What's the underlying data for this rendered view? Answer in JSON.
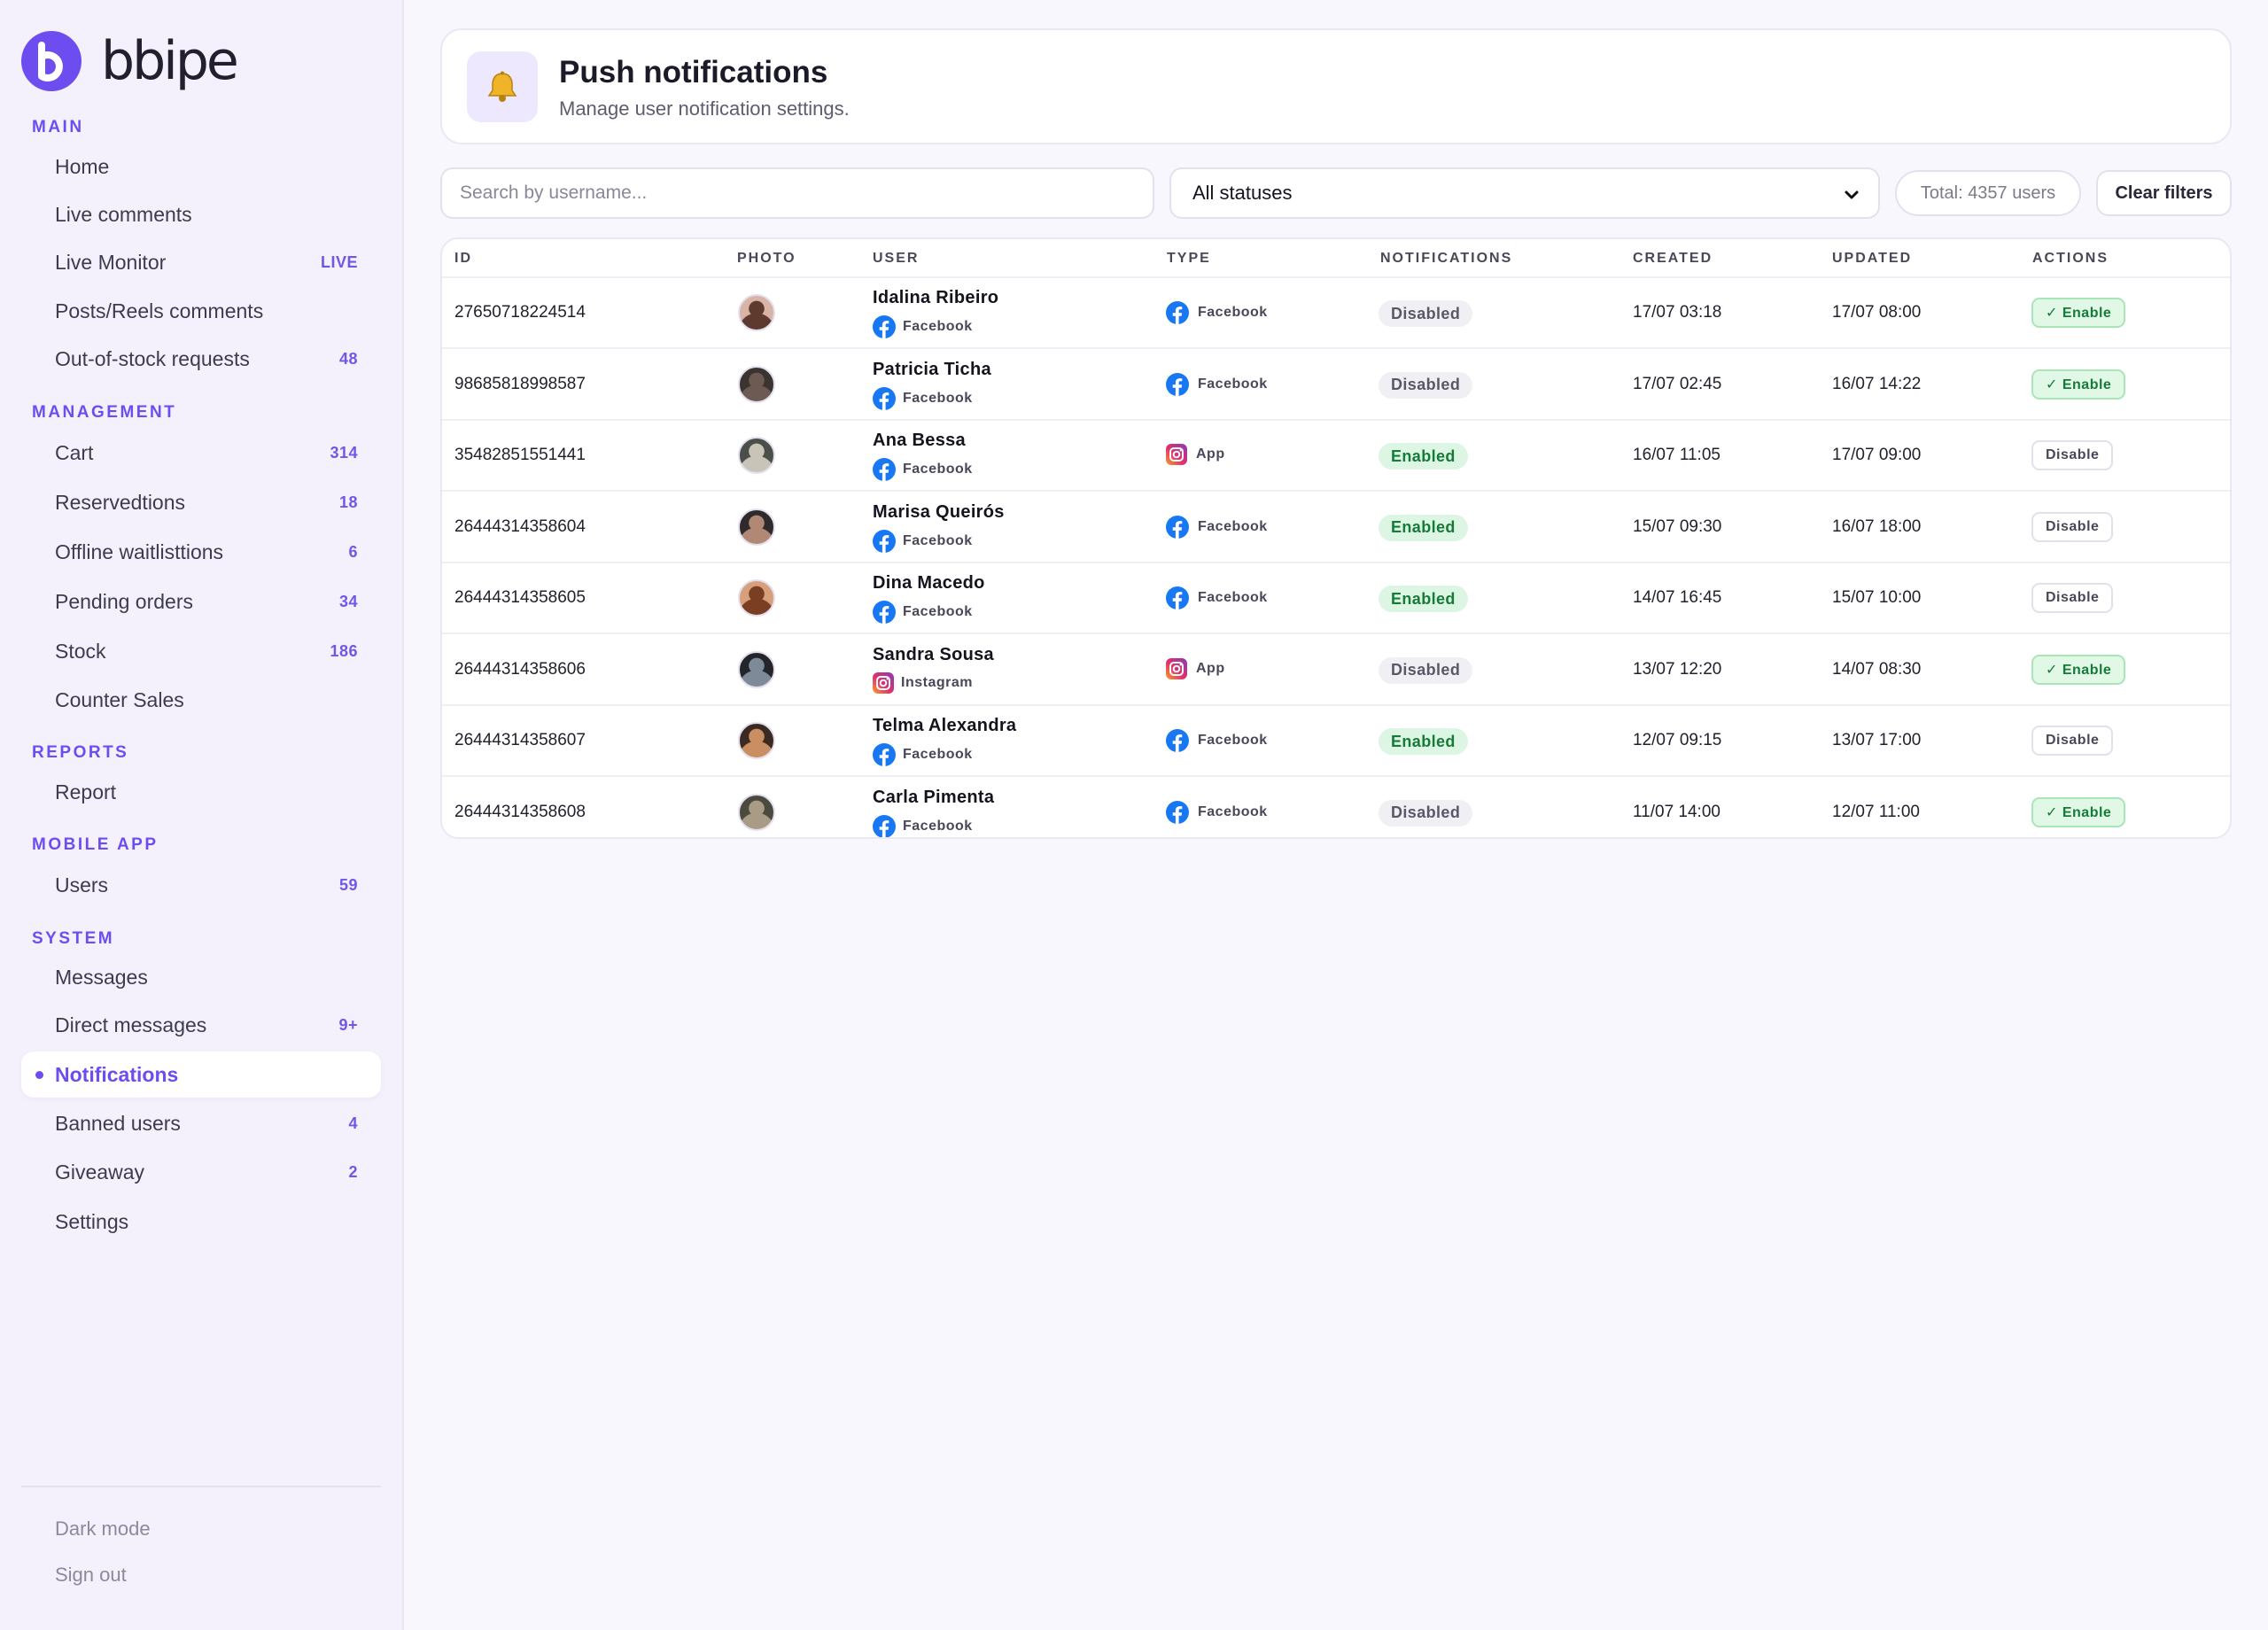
{
  "brand": {
    "name": "bbipe"
  },
  "sidebar": {
    "sections": {
      "main": "MAIN",
      "management": "MANAGEMENT",
      "reports": "REPORTS",
      "mobile_app": "MOBILE APP",
      "system": "SYSTEM"
    },
    "items": {
      "home": {
        "label": "Home"
      },
      "live_comments": {
        "label": "Live comments"
      },
      "live_monitor": {
        "label": "Live Monitor",
        "badge": "LIVE"
      },
      "posts_reels": {
        "label": "Posts/Reels comments"
      },
      "out_of_stock": {
        "label": "Out-of-stock requests",
        "badge": "48"
      },
      "cart": {
        "label": "Cart",
        "badge": "314"
      },
      "reservations": {
        "label": "Reservedtions",
        "badge": "18"
      },
      "offline_waitlists": {
        "label": "Offline waitlisttions",
        "badge": "6"
      },
      "pending_orders": {
        "label": "Pending orders",
        "badge": "34"
      },
      "stock": {
        "label": "Stock",
        "badge": "186"
      },
      "counter_sales": {
        "label": "Counter Sales"
      },
      "report": {
        "label": "Report"
      },
      "users": {
        "label": "Users",
        "badge": "59"
      },
      "messages": {
        "label": "Messages"
      },
      "direct_messages": {
        "label": "Direct messages",
        "badge": "9+"
      },
      "notifications": {
        "label": "Notifications"
      },
      "banned_users": {
        "label": "Banned users",
        "badge": "4"
      },
      "giveaway": {
        "label": "Giveaway",
        "badge": "2"
      },
      "settings": {
        "label": "Settings"
      }
    },
    "footer": {
      "dark_mode": "Dark mode",
      "sign_out": "Sign out"
    }
  },
  "header": {
    "icon": "bell-icon",
    "title": "Push notifications",
    "subtitle": "Manage user notification settings."
  },
  "filters": {
    "search_placeholder": "Search by username...",
    "status_selected": "All statuses",
    "total": "Total: 4357 users",
    "clear": "Clear filters"
  },
  "table": {
    "columns": [
      "ID",
      "PHOTO",
      "USER",
      "TYPE",
      "NOTIFICATIONS",
      "CREATED",
      "UPDATED",
      "ACTIONS"
    ],
    "rows": [
      {
        "id": "27650718224514",
        "name": "Idalina Ribeiro",
        "source": "Facebook",
        "source_icon": "facebook-icon",
        "type": "Facebook",
        "type_icon": "facebook-icon",
        "notifications": "Disabled",
        "created": "17/07 03:18",
        "updated": "17/07 08:00",
        "action": "✓ Enable"
      },
      {
        "id": "98685818998587",
        "name": "Patricia Ticha",
        "source": "Facebook",
        "source_icon": "facebook-icon",
        "type": "Facebook",
        "type_icon": "facebook-icon",
        "notifications": "Disabled",
        "created": "17/07 02:45",
        "updated": "16/07 14:22",
        "action": "✓ Enable"
      },
      {
        "id": "35482851551441",
        "name": "Ana Bessa",
        "source": "Facebook",
        "source_icon": "facebook-icon",
        "type": "App",
        "type_icon": "instagram-icon",
        "notifications": "Enabled",
        "created": "16/07 11:05",
        "updated": "17/07 09:00",
        "action": "Disable"
      },
      {
        "id": "26444314358604",
        "name": "Marisa Queirós",
        "source": "Facebook",
        "source_icon": "facebook-icon",
        "type": "Facebook",
        "type_icon": "facebook-icon",
        "notifications": "Enabled",
        "created": "15/07 09:30",
        "updated": "16/07 18:00",
        "action": "Disable"
      },
      {
        "id": "26444314358605",
        "name": "Dina Macedo",
        "source": "Facebook",
        "source_icon": "facebook-icon",
        "type": "Facebook",
        "type_icon": "facebook-icon",
        "notifications": "Enabled",
        "created": "14/07 16:45",
        "updated": "15/07 10:00",
        "action": "Disable"
      },
      {
        "id": "26444314358606",
        "name": "Sandra Sousa",
        "source": "Instagram",
        "source_icon": "instagram-icon",
        "type": "App",
        "type_icon": "instagram-icon",
        "notifications": "Disabled",
        "created": "13/07 12:20",
        "updated": "14/07 08:30",
        "action": "✓ Enable"
      },
      {
        "id": "26444314358607",
        "name": "Telma Alexandra",
        "source": "Facebook",
        "source_icon": "facebook-icon",
        "type": "Facebook",
        "type_icon": "facebook-icon",
        "notifications": "Enabled",
        "created": "12/07 09:15",
        "updated": "13/07 17:00",
        "action": "Disable"
      },
      {
        "id": "26444314358608",
        "name": "Carla Pimenta",
        "source": "Facebook",
        "source_icon": "facebook-icon",
        "type": "Facebook",
        "type_icon": "facebook-icon",
        "notifications": "Disabled",
        "created": "11/07 14:00",
        "updated": "12/07 11:00",
        "action": "✓ Enable"
      }
    ]
  },
  "colors": {
    "accent": "#6d4df0",
    "enabled_bg": "#dcf6e3",
    "enabled_text": "#167a38",
    "facebook": "#1877f2",
    "instagram": "#d62976"
  }
}
